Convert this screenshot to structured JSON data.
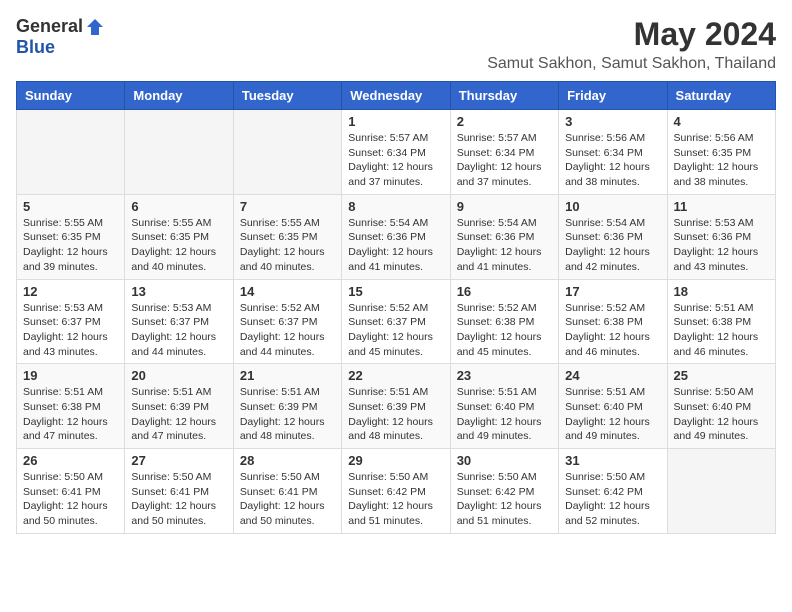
{
  "logo": {
    "general": "General",
    "blue": "Blue"
  },
  "title": {
    "month": "May 2024",
    "location": "Samut Sakhon, Samut Sakhon, Thailand"
  },
  "headers": [
    "Sunday",
    "Monday",
    "Tuesday",
    "Wednesday",
    "Thursday",
    "Friday",
    "Saturday"
  ],
  "weeks": [
    [
      {
        "day": "",
        "sunrise": "",
        "sunset": "",
        "daylight": ""
      },
      {
        "day": "",
        "sunrise": "",
        "sunset": "",
        "daylight": ""
      },
      {
        "day": "",
        "sunrise": "",
        "sunset": "",
        "daylight": ""
      },
      {
        "day": "1",
        "sunrise": "Sunrise: 5:57 AM",
        "sunset": "Sunset: 6:34 PM",
        "daylight": "Daylight: 12 hours and 37 minutes."
      },
      {
        "day": "2",
        "sunrise": "Sunrise: 5:57 AM",
        "sunset": "Sunset: 6:34 PM",
        "daylight": "Daylight: 12 hours and 37 minutes."
      },
      {
        "day": "3",
        "sunrise": "Sunrise: 5:56 AM",
        "sunset": "Sunset: 6:34 PM",
        "daylight": "Daylight: 12 hours and 38 minutes."
      },
      {
        "day": "4",
        "sunrise": "Sunrise: 5:56 AM",
        "sunset": "Sunset: 6:35 PM",
        "daylight": "Daylight: 12 hours and 38 minutes."
      }
    ],
    [
      {
        "day": "5",
        "sunrise": "Sunrise: 5:55 AM",
        "sunset": "Sunset: 6:35 PM",
        "daylight": "Daylight: 12 hours and 39 minutes."
      },
      {
        "day": "6",
        "sunrise": "Sunrise: 5:55 AM",
        "sunset": "Sunset: 6:35 PM",
        "daylight": "Daylight: 12 hours and 40 minutes."
      },
      {
        "day": "7",
        "sunrise": "Sunrise: 5:55 AM",
        "sunset": "Sunset: 6:35 PM",
        "daylight": "Daylight: 12 hours and 40 minutes."
      },
      {
        "day": "8",
        "sunrise": "Sunrise: 5:54 AM",
        "sunset": "Sunset: 6:36 PM",
        "daylight": "Daylight: 12 hours and 41 minutes."
      },
      {
        "day": "9",
        "sunrise": "Sunrise: 5:54 AM",
        "sunset": "Sunset: 6:36 PM",
        "daylight": "Daylight: 12 hours and 41 minutes."
      },
      {
        "day": "10",
        "sunrise": "Sunrise: 5:54 AM",
        "sunset": "Sunset: 6:36 PM",
        "daylight": "Daylight: 12 hours and 42 minutes."
      },
      {
        "day": "11",
        "sunrise": "Sunrise: 5:53 AM",
        "sunset": "Sunset: 6:36 PM",
        "daylight": "Daylight: 12 hours and 43 minutes."
      }
    ],
    [
      {
        "day": "12",
        "sunrise": "Sunrise: 5:53 AM",
        "sunset": "Sunset: 6:37 PM",
        "daylight": "Daylight: 12 hours and 43 minutes."
      },
      {
        "day": "13",
        "sunrise": "Sunrise: 5:53 AM",
        "sunset": "Sunset: 6:37 PM",
        "daylight": "Daylight: 12 hours and 44 minutes."
      },
      {
        "day": "14",
        "sunrise": "Sunrise: 5:52 AM",
        "sunset": "Sunset: 6:37 PM",
        "daylight": "Daylight: 12 hours and 44 minutes."
      },
      {
        "day": "15",
        "sunrise": "Sunrise: 5:52 AM",
        "sunset": "Sunset: 6:37 PM",
        "daylight": "Daylight: 12 hours and 45 minutes."
      },
      {
        "day": "16",
        "sunrise": "Sunrise: 5:52 AM",
        "sunset": "Sunset: 6:38 PM",
        "daylight": "Daylight: 12 hours and 45 minutes."
      },
      {
        "day": "17",
        "sunrise": "Sunrise: 5:52 AM",
        "sunset": "Sunset: 6:38 PM",
        "daylight": "Daylight: 12 hours and 46 minutes."
      },
      {
        "day": "18",
        "sunrise": "Sunrise: 5:51 AM",
        "sunset": "Sunset: 6:38 PM",
        "daylight": "Daylight: 12 hours and 46 minutes."
      }
    ],
    [
      {
        "day": "19",
        "sunrise": "Sunrise: 5:51 AM",
        "sunset": "Sunset: 6:38 PM",
        "daylight": "Daylight: 12 hours and 47 minutes."
      },
      {
        "day": "20",
        "sunrise": "Sunrise: 5:51 AM",
        "sunset": "Sunset: 6:39 PM",
        "daylight": "Daylight: 12 hours and 47 minutes."
      },
      {
        "day": "21",
        "sunrise": "Sunrise: 5:51 AM",
        "sunset": "Sunset: 6:39 PM",
        "daylight": "Daylight: 12 hours and 48 minutes."
      },
      {
        "day": "22",
        "sunrise": "Sunrise: 5:51 AM",
        "sunset": "Sunset: 6:39 PM",
        "daylight": "Daylight: 12 hours and 48 minutes."
      },
      {
        "day": "23",
        "sunrise": "Sunrise: 5:51 AM",
        "sunset": "Sunset: 6:40 PM",
        "daylight": "Daylight: 12 hours and 49 minutes."
      },
      {
        "day": "24",
        "sunrise": "Sunrise: 5:51 AM",
        "sunset": "Sunset: 6:40 PM",
        "daylight": "Daylight: 12 hours and 49 minutes."
      },
      {
        "day": "25",
        "sunrise": "Sunrise: 5:50 AM",
        "sunset": "Sunset: 6:40 PM",
        "daylight": "Daylight: 12 hours and 49 minutes."
      }
    ],
    [
      {
        "day": "26",
        "sunrise": "Sunrise: 5:50 AM",
        "sunset": "Sunset: 6:41 PM",
        "daylight": "Daylight: 12 hours and 50 minutes."
      },
      {
        "day": "27",
        "sunrise": "Sunrise: 5:50 AM",
        "sunset": "Sunset: 6:41 PM",
        "daylight": "Daylight: 12 hours and 50 minutes."
      },
      {
        "day": "28",
        "sunrise": "Sunrise: 5:50 AM",
        "sunset": "Sunset: 6:41 PM",
        "daylight": "Daylight: 12 hours and 50 minutes."
      },
      {
        "day": "29",
        "sunrise": "Sunrise: 5:50 AM",
        "sunset": "Sunset: 6:42 PM",
        "daylight": "Daylight: 12 hours and 51 minutes."
      },
      {
        "day": "30",
        "sunrise": "Sunrise: 5:50 AM",
        "sunset": "Sunset: 6:42 PM",
        "daylight": "Daylight: 12 hours and 51 minutes."
      },
      {
        "day": "31",
        "sunrise": "Sunrise: 5:50 AM",
        "sunset": "Sunset: 6:42 PM",
        "daylight": "Daylight: 12 hours and 52 minutes."
      },
      {
        "day": "",
        "sunrise": "",
        "sunset": "",
        "daylight": ""
      }
    ]
  ]
}
